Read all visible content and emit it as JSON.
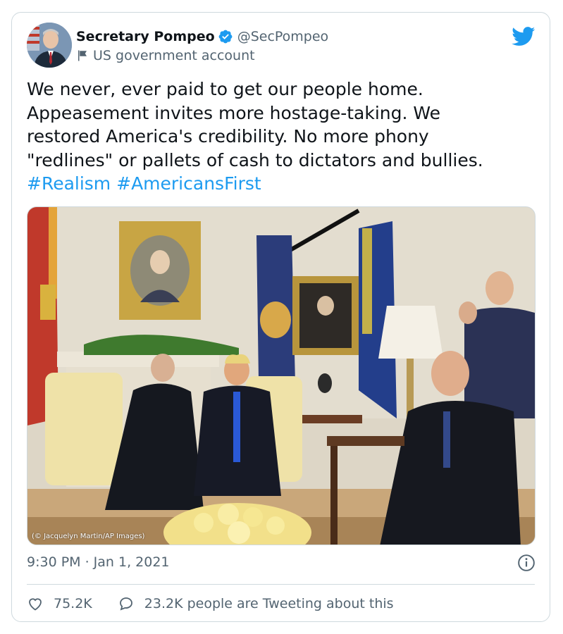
{
  "author": {
    "display_name": "Secretary Pompeo",
    "handle": "@SecPompeo",
    "label": "US government account"
  },
  "tweet": {
    "lines": [
      "We never, ever paid to get our people home.",
      "Appeasement invites more hostage-taking. We",
      "restored America's credibility. No more phony",
      "\"redlines\" or pallets of cash to dictators and bullies."
    ],
    "hashtags": [
      "#Realism",
      "#AmericansFirst"
    ]
  },
  "media": {
    "credit": "(© Jacquelyn Martin/AP Images)"
  },
  "meta": {
    "timestamp": "9:30 PM · Jan 1, 2021"
  },
  "actions": {
    "likes": "75.2K",
    "conversation": "23.2K people are Tweeting about this"
  },
  "colors": {
    "accent": "#1d9bf0",
    "secondary_text": "#536471",
    "border": "#cfd9de",
    "text": "#0f1419"
  },
  "icons": {
    "verified": "verified-badge-icon",
    "government": "flag-icon",
    "logo": "twitter-bird-icon",
    "info": "info-icon",
    "like": "heart-icon",
    "reply": "speech-bubble-icon"
  }
}
